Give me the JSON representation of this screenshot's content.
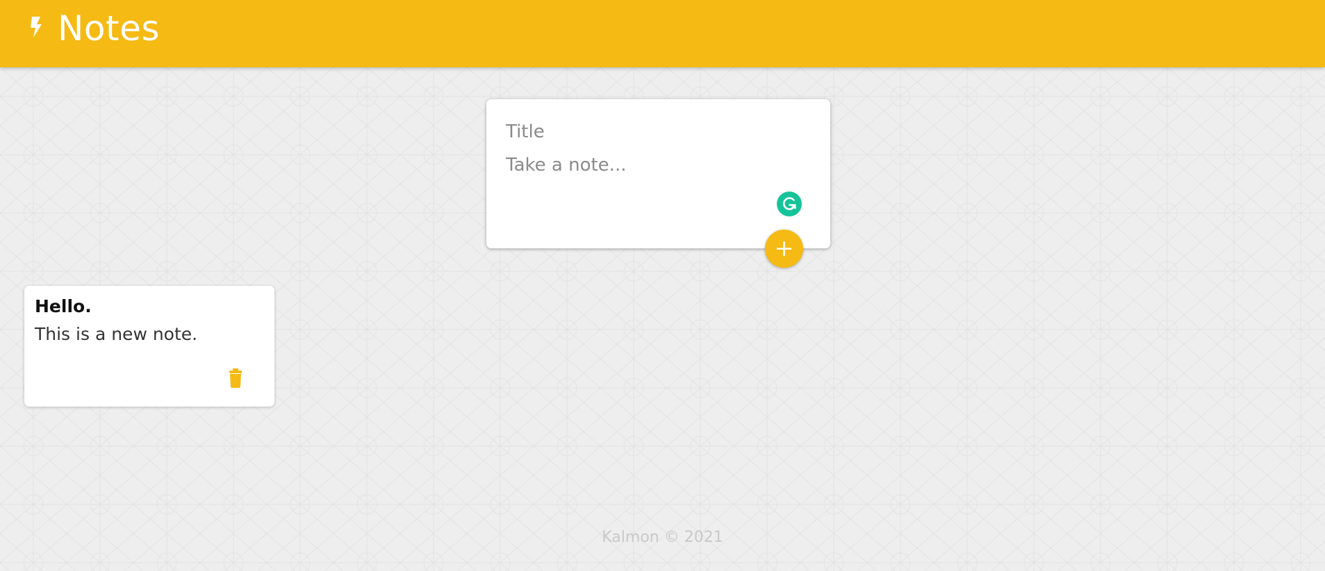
{
  "header": {
    "title": "Notes",
    "icon": "flash-icon",
    "color": "#f5ba13"
  },
  "create_area": {
    "title_placeholder": "Title",
    "content_placeholder": "Take a note...",
    "grammar_icon": "grammarly-icon",
    "add_icon": "plus-icon"
  },
  "notes": [
    {
      "title": "Hello.",
      "content": "This is a new note.",
      "delete_icon": "trash-icon"
    }
  ],
  "footer": {
    "text": "Kalmon © 2021"
  },
  "colors": {
    "accent": "#f5ba13",
    "background": "#eeeeee",
    "grammarly": "#15c39a"
  }
}
